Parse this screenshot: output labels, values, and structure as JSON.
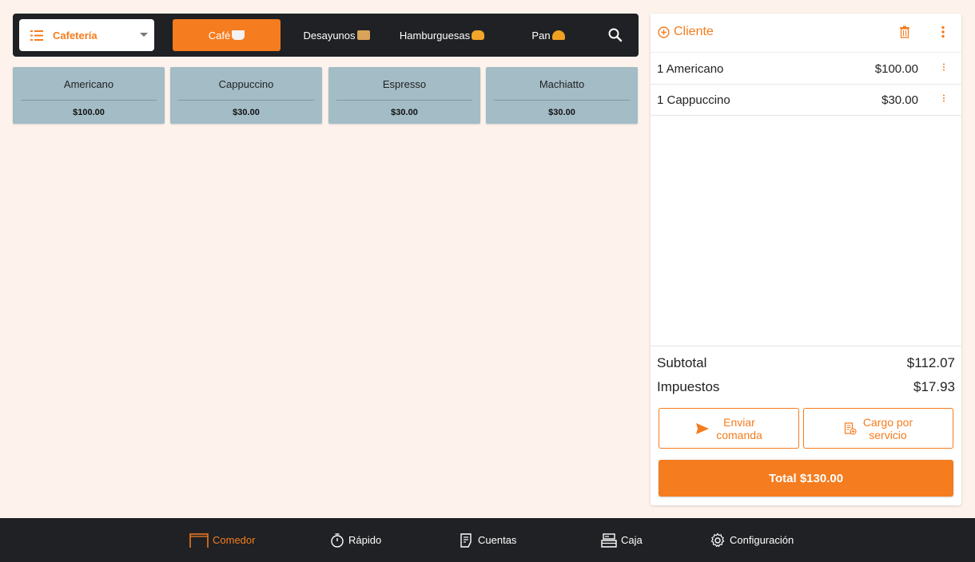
{
  "category_selector": {
    "label": "Cafetería"
  },
  "tabs": [
    {
      "label": "Café",
      "emoji_color": "#f3f3f3",
      "active": true
    },
    {
      "label": "Desayunos",
      "emoji_color": "#d9a35a",
      "active": false
    },
    {
      "label": "Hamburguesas",
      "emoji_color": "#f2a52a",
      "active": false
    },
    {
      "label": "Pan",
      "emoji_color": "#f0a023",
      "active": false
    }
  ],
  "products": [
    {
      "name": "Americano",
      "price": "$100.00"
    },
    {
      "name": "Cappuccino",
      "price": "$30.00"
    },
    {
      "name": "Espresso",
      "price": "$30.00"
    },
    {
      "name": "Machiatto",
      "price": "$30.00"
    }
  ],
  "order": {
    "client_label": "Cliente",
    "lines": [
      {
        "text": "1 Americano",
        "amount": "$100.00"
      },
      {
        "text": "1 Cappuccino",
        "amount": "$30.00"
      }
    ],
    "subtotal_label": "Subtotal",
    "subtotal_value": "$112.07",
    "tax_label": "Impuestos",
    "tax_value": "$17.93",
    "send_label_1": "Enviar",
    "send_label_2": "comanda",
    "service_label_1": "Cargo por",
    "service_label_2": "servicio",
    "total_label": "Total $130.00"
  },
  "nav": [
    {
      "label": "Comedor",
      "icon": "table-icon",
      "active": true
    },
    {
      "label": "Rápido",
      "icon": "timer-icon",
      "active": false
    },
    {
      "label": "Cuentas",
      "icon": "receipt-icon",
      "active": false
    },
    {
      "label": "Caja",
      "icon": "register-icon",
      "active": false
    },
    {
      "label": "Configuración",
      "icon": "gear-icon",
      "active": false
    }
  ],
  "colors": {
    "accent": "#f57c1f",
    "dark_bar": "#1f2124",
    "product_tile": "#a3bcc6",
    "background": "#fdf3ec"
  }
}
